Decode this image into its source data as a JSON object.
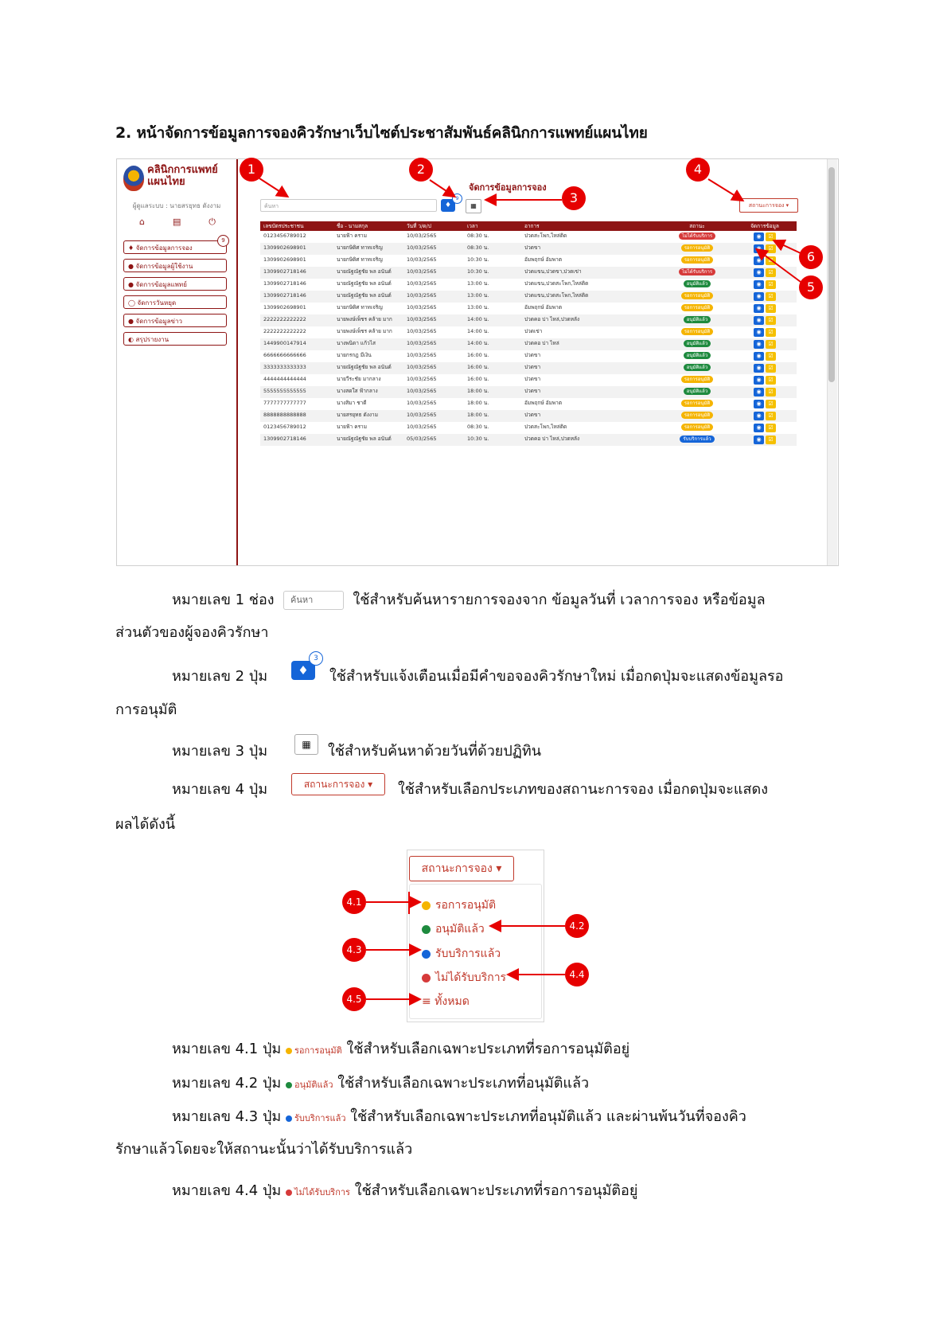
{
  "heading": "2. หน้าจัดการข้อมูลการจองคิวรักษาเว็บไซต์ประชาสัมพันธ์คลินิกการแพทย์แผนไทย",
  "screenshot": {
    "logo_line1": "คลินิกการแพทย์",
    "logo_line2": "แผนไทย",
    "admin_line": "ผู้ดูแลระบบ : นายสรยุทธ ดังงาม",
    "menu": [
      {
        "label": "จัดการข้อมูลการจอง",
        "badge": "9"
      },
      {
        "label": "จัดการข้อมูลผู้ใช้งาน"
      },
      {
        "label": "จัดการข้อมูลแพทย์"
      },
      {
        "label": "จัดการวันหยุด"
      },
      {
        "label": "จัดการข้อมูลข่าว"
      },
      {
        "label": "สรุปรายงาน"
      }
    ],
    "page_title": "จัดการข้อมูลการจอง",
    "search_placeholder": "ค้นหา",
    "bell_badge": "9",
    "status_button": "สถานะการจอง ▾",
    "columns": [
      "เลขบัตรประชาชน",
      "ชื่อ - นามสกุล",
      "วันที่ ว/ด/ป",
      "เวลา",
      "อาการ",
      "สถานะ",
      "จัดการข้อมูล"
    ],
    "rows": [
      {
        "id": "0123456789012",
        "name": "นายฟ้า คราม",
        "date": "10/03/2565",
        "time": "08:30 น.",
        "symptom": "ปวดสะโพก,ไหล่ติด",
        "status": "ไม่ได้รับบริการ",
        "color": "#d63a3a"
      },
      {
        "id": "1309902698901",
        "name": "นายกษิดิศ ทาทเจริญ",
        "date": "10/03/2565",
        "time": "08:30 น.",
        "symptom": "ปวดขา",
        "status": "รอการอนุมัติ",
        "color": "#f5b400"
      },
      {
        "id": "1309902698901",
        "name": "นายกษิดิศ ทาทเจริญ",
        "date": "10/03/2565",
        "time": "10:30 น.",
        "symptom": "อัมพฤกษ์ อัมพาต",
        "status": "รอการอนุมัติ",
        "color": "#f5b400"
      },
      {
        "id": "1309902718146",
        "name": "นายณัฐณัฐชัย พล อนันต์",
        "date": "10/03/2565",
        "time": "10:30 น.",
        "symptom": "ปวดแขน,ปวดขา,ปวดเข่า",
        "status": "ไม่ได้รับบริการ",
        "color": "#d63a3a"
      },
      {
        "id": "1309902718146",
        "name": "นายณัฐณัฐชัย พล อนันต์",
        "date": "10/03/2565",
        "time": "13:00 น.",
        "symptom": "ปวดแขน,ปวดสะโพก,ไหล่ติด",
        "status": "อนุมัติแล้ว",
        "color": "#1e8a3e"
      },
      {
        "id": "1309902718146",
        "name": "นายณัฐณัฐชัย พล อนันต์",
        "date": "10/03/2565",
        "time": "13:00 น.",
        "symptom": "ปวดแขน,ปวดสะโพก,ไหล่ติด",
        "status": "รอการอนุมัติ",
        "color": "#f5b400"
      },
      {
        "id": "1309902698901",
        "name": "นายกษิดิศ ทาทเจริญ",
        "date": "10/03/2565",
        "time": "13:00 น.",
        "symptom": "อัมพฤกษ์ อัมพาต",
        "status": "รอการอนุมัติ",
        "color": "#f5b400"
      },
      {
        "id": "2222222222222",
        "name": "นายพงษ์เพ็ชร คล้าย มาก",
        "date": "10/03/2565",
        "time": "14:00 น.",
        "symptom": "ปวดคอ บ่า ไหล่,ปวดหลัง",
        "status": "อนุมัติแล้ว",
        "color": "#1e8a3e"
      },
      {
        "id": "2222222222222",
        "name": "นายพงษ์เพ็ชร คล้าย มาก",
        "date": "10/03/2565",
        "time": "14:00 น.",
        "symptom": "ปวดเข่า",
        "status": "รอการอนุมัติ",
        "color": "#f5b400"
      },
      {
        "id": "1449900147914",
        "name": "นางพนิดา แก้วไส",
        "date": "10/03/2565",
        "time": "14:00 น.",
        "symptom": "ปวดคอ บ่า ไหล่",
        "status": "อนุมัติแล้ว",
        "color": "#1e8a3e"
      },
      {
        "id": "6666666666666",
        "name": "นายกรกฎ มีเงิน",
        "date": "10/03/2565",
        "time": "16:00 น.",
        "symptom": "ปวดขา",
        "status": "อนุมัติแล้ว",
        "color": "#1e8a3e"
      },
      {
        "id": "3333333333333",
        "name": "นายณัฐณัฐชัย พล อนันต์",
        "date": "10/03/2565",
        "time": "16:00 น.",
        "symptom": "ปวดขา",
        "status": "อนุมัติแล้ว",
        "color": "#1e8a3e"
      },
      {
        "id": "4444444444444",
        "name": "นายวีระชัย มากลาง",
        "date": "10/03/2565",
        "time": "16:00 น.",
        "symptom": "ปวดขา",
        "status": "รอการอนุมัติ",
        "color": "#f5b400"
      },
      {
        "id": "5555555555555",
        "name": "นางสดใส ฟ้ากลาง",
        "date": "10/03/2565",
        "time": "18:00 น.",
        "symptom": "ปวดขา",
        "status": "อนุมัติแล้ว",
        "color": "#1e8a3e"
      },
      {
        "id": "7777777777777",
        "name": "นางสิมา ชาดี",
        "date": "10/03/2565",
        "time": "18:00 น.",
        "symptom": "อัมพฤกษ์ อัมพาต",
        "status": "รอการอนุมัติ",
        "color": "#f5b400"
      },
      {
        "id": "8888888888888",
        "name": "นายสรยุทธ ดังงาม",
        "date": "10/03/2565",
        "time": "18:00 น.",
        "symptom": "ปวดขา",
        "status": "รอการอนุมัติ",
        "color": "#f5b400"
      },
      {
        "id": "0123456789012",
        "name": "นายฟ้า คราม",
        "date": "10/03/2565",
        "time": "08:30 น.",
        "symptom": "ปวดสะโพก,ไหล่ติด",
        "status": "รอการอนุมัติ",
        "color": "#f5b400"
      },
      {
        "id": "1309902718146",
        "name": "นายณัฐณัฐชัย พล อนันต์",
        "date": "05/03/2565",
        "time": "10:30 น.",
        "symptom": "ปวดคอ บ่า ไหล่,ปวดหลัง",
        "status": "รับบริการแล้ว",
        "color": "#1565d8"
      }
    ],
    "callouts": [
      "1",
      "2",
      "3",
      "4",
      "5",
      "6"
    ]
  },
  "paragraphs": {
    "p1_label": "หมายเลข 1 ช่อง",
    "p1_input": "ค้นหา",
    "p1_text": "ใช้สำหรับค้นหารายการจองจาก ข้อมูลวันที่ เวลาการจอง หรือข้อมูล",
    "p1_cont": "ส่วนตัวของผู้จองคิวรักษา",
    "p2_label": "หมายเลข 2 ปุ่ม",
    "p2_badge": "3",
    "p2_text": "ใช้สำหรับแจ้งเตือนเมื่อมีคำขอจองคิวรักษาใหม่ เมื่อกดปุ่มจะแสดงข้อมูลรอ",
    "p2_cont": "การอนุมัติ",
    "p3_label": "หมายเลข 3 ปุ่ม",
    "p3_text": "ใช้สำหรับค้นหาด้วยวันที่ด้วยปฏิทิน",
    "p4_label": "หมายเลข 4 ปุ่ม",
    "p4_button": "สถานะการจอง ▾",
    "p4_text": "ใช้สำหรับเลือกประเภทของสถานะการจอง เมื่อกดปุ่มจะแสดง",
    "p4_cont": "ผลได้ดังนี้",
    "p41_label": "หมายเลข 4.1 ปุ่ม",
    "p41_opt": "รอการอนุมัติ",
    "p41_text": "ใช้สำหรับเลือกเฉพาะประเภทที่รอการอนุมัติอยู่",
    "p42_label": "หมายเลข 4.2 ปุ่ม",
    "p42_opt": "อนุมัติแล้ว",
    "p42_text": "ใช้สำหรับเลือกเฉพาะประเภทที่อนุมัติแล้ว",
    "p43_label": "หมายเลข 4.3 ปุ่ม",
    "p43_opt": "รับบริการแล้ว",
    "p43_text": "ใช้สำหรับเลือกเฉพาะประเภทที่อนุมัติแล้ว และผ่านพ้นวันที่จองคิว",
    "p43_cont": "รักษาแล้วโดยจะให้สถานะนั้นว่าได้รับบริการแล้ว",
    "p44_label": "หมายเลข 4.4 ปุ่ม",
    "p44_opt": "ไม่ได้รับบริการ",
    "p44_text": "ใช้สำหรับเลือกเฉพาะประเภทที่รอการอนุมัติอยู่"
  },
  "dropdown": {
    "button": "สถานะการจอง ▾",
    "items": [
      "รอการอนุมัติ",
      "อนุมัติแล้ว",
      "รับบริการแล้ว",
      "ไม่ได้รับบริการ",
      "≡ ทั้งหมด"
    ],
    "callouts": [
      "4.1",
      "4.2",
      "4.3",
      "4.4",
      "4.5"
    ]
  },
  "colors": {
    "primary": "#8e1414",
    "callout": "#e60000",
    "pending": "#f5b400",
    "approved": "#1e8a3e",
    "served": "#1565d8",
    "not_served": "#d63a3a"
  }
}
